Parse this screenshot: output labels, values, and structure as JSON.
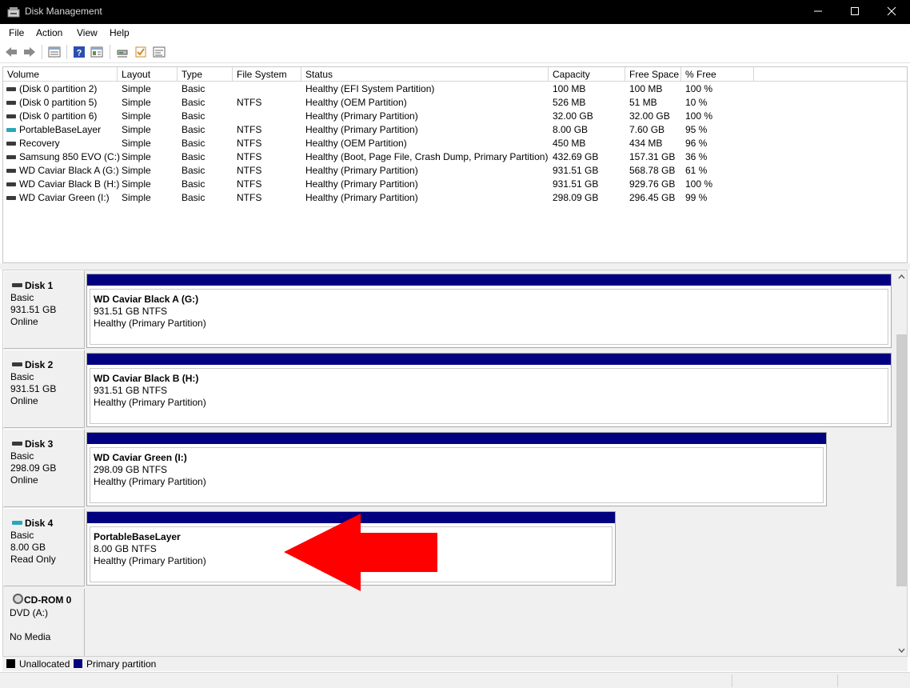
{
  "window": {
    "title": "Disk Management"
  },
  "menu": [
    "File",
    "Action",
    "View",
    "Help"
  ],
  "toolbar_icons": [
    "back-icon",
    "forward-icon",
    "list-view-icon",
    "help-icon",
    "properties-icon",
    "connect-icon",
    "check-icon",
    "settings-panel-icon"
  ],
  "columns": [
    "Volume",
    "Layout",
    "Type",
    "File System",
    "Status",
    "Capacity",
    "Free Space",
    "% Free"
  ],
  "volumes": [
    {
      "volume": "(Disk 0 partition 2)",
      "layout": "Simple",
      "type": "Basic",
      "fs": "",
      "status": "Healthy (EFI System Partition)",
      "capacity": "100 MB",
      "free": "100 MB",
      "pct": "100 %",
      "icon": "disk"
    },
    {
      "volume": "(Disk 0 partition 5)",
      "layout": "Simple",
      "type": "Basic",
      "fs": "NTFS",
      "status": "Healthy (OEM Partition)",
      "capacity": "526 MB",
      "free": "51 MB",
      "pct": "10 %",
      "icon": "disk"
    },
    {
      "volume": "(Disk 0 partition 6)",
      "layout": "Simple",
      "type": "Basic",
      "fs": "",
      "status": "Healthy (Primary Partition)",
      "capacity": "32.00 GB",
      "free": "32.00 GB",
      "pct": "100 %",
      "icon": "disk"
    },
    {
      "volume": "PortableBaseLayer",
      "layout": "Simple",
      "type": "Basic",
      "fs": "NTFS",
      "status": "Healthy (Primary Partition)",
      "capacity": "8.00 GB",
      "free": "7.60 GB",
      "pct": "95 %",
      "icon": "usb"
    },
    {
      "volume": "Recovery",
      "layout": "Simple",
      "type": "Basic",
      "fs": "NTFS",
      "status": "Healthy (OEM Partition)",
      "capacity": "450 MB",
      "free": "434 MB",
      "pct": "96 %",
      "icon": "disk"
    },
    {
      "volume": "Samsung 850 EVO (C:)",
      "layout": "Simple",
      "type": "Basic",
      "fs": "NTFS",
      "status": "Healthy (Boot, Page File, Crash Dump, Primary Partition)",
      "capacity": "432.69 GB",
      "free": "157.31 GB",
      "pct": "36 %",
      "icon": "disk"
    },
    {
      "volume": "WD Caviar Black A (G:)",
      "layout": "Simple",
      "type": "Basic",
      "fs": "NTFS",
      "status": "Healthy (Primary Partition)",
      "capacity": "931.51 GB",
      "free": "568.78 GB",
      "pct": "61 %",
      "icon": "disk"
    },
    {
      "volume": "WD Caviar Black B (H:)",
      "layout": "Simple",
      "type": "Basic",
      "fs": "NTFS",
      "status": "Healthy (Primary Partition)",
      "capacity": "931.51 GB",
      "free": "929.76 GB",
      "pct": "100 %",
      "icon": "disk"
    },
    {
      "volume": "WD Caviar Green (I:)",
      "layout": "Simple",
      "type": "Basic",
      "fs": "NTFS",
      "status": "Healthy (Primary Partition)",
      "capacity": "298.09 GB",
      "free": "296.45 GB",
      "pct": "99 %",
      "icon": "disk"
    }
  ],
  "disks": [
    {
      "name": "Disk 1",
      "kind": "Basic",
      "size": "931.51 GB",
      "state": "Online",
      "icon": "disk",
      "partition": {
        "name": "WD Caviar Black A  (G:)",
        "size_fs": "931.51 GB NTFS",
        "status": "Healthy (Primary Partition)"
      }
    },
    {
      "name": "Disk 2",
      "kind": "Basic",
      "size": "931.51 GB",
      "state": "Online",
      "icon": "disk",
      "partition": {
        "name": "WD Caviar Black B  (H:)",
        "size_fs": "931.51 GB NTFS",
        "status": "Healthy (Primary Partition)"
      }
    },
    {
      "name": "Disk 3",
      "kind": "Basic",
      "size": "298.09 GB",
      "state": "Online",
      "icon": "disk",
      "partition": {
        "name": "WD Caviar Green  (I:)",
        "size_fs": "298.09 GB NTFS",
        "status": "Healthy (Primary Partition)"
      }
    },
    {
      "name": "Disk 4",
      "kind": "Basic",
      "size": "8.00 GB",
      "state": "Read Only",
      "icon": "usb",
      "partition": {
        "name": "PortableBaseLayer",
        "size_fs": "8.00 GB NTFS",
        "status": "Healthy (Primary Partition)"
      }
    }
  ],
  "cdrom": {
    "name": "CD-ROM 0",
    "drive": "DVD (A:)",
    "media": "No Media"
  },
  "legend": [
    {
      "label": "Unallocated",
      "color": "#000000"
    },
    {
      "label": "Primary partition",
      "color": "#000080"
    }
  ],
  "colors": {
    "partition_bar": "#000080",
    "annotation_arrow": "#ff0000",
    "usb_icon": "#2aa6b8"
  }
}
